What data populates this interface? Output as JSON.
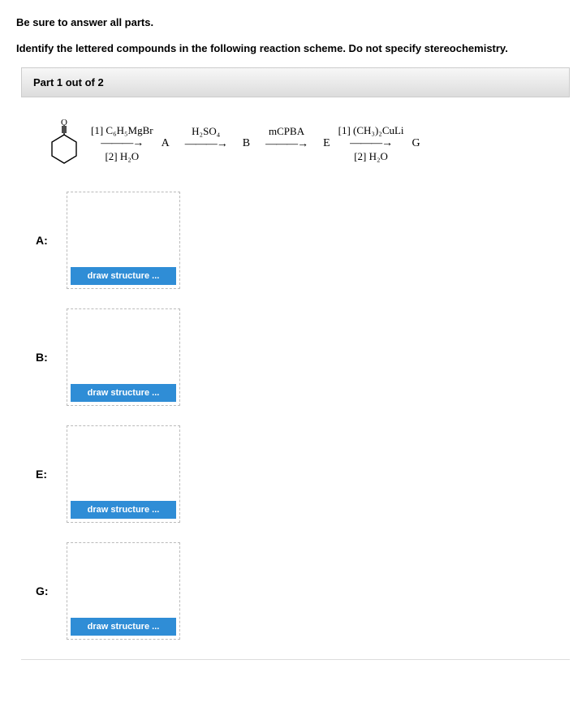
{
  "instructions": {
    "line1": "Be sure to answer all parts.",
    "line2": "Identify the lettered compounds in the following reaction scheme. Do not specify stereochemistry."
  },
  "part_header": "Part 1 out of 2",
  "scheme": {
    "start_label": "O",
    "steps": [
      {
        "top": "[1] C₆H₅MgBr",
        "bottom": "[2] H₂O",
        "product": "A"
      },
      {
        "top": "H₂SO₄",
        "bottom": "",
        "product": "B"
      },
      {
        "top": "mCPBA",
        "bottom": "",
        "product": "E"
      },
      {
        "top": "[1] (CH₃)₂CuLi",
        "bottom": "[2] H₂O",
        "product": "G"
      }
    ]
  },
  "answers": [
    {
      "label": "A:",
      "button": "draw structure ..."
    },
    {
      "label": "B:",
      "button": "draw structure ..."
    },
    {
      "label": "E:",
      "button": "draw structure ..."
    },
    {
      "label": "G:",
      "button": "draw structure ..."
    }
  ],
  "arrow_glyph": "———→"
}
